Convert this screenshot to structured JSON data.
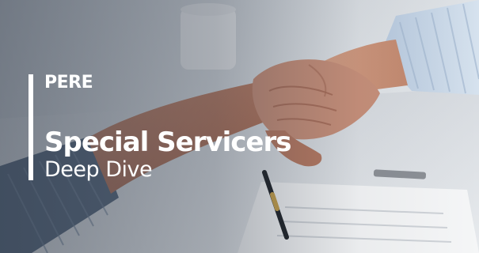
{
  "banner": {
    "kicker": "PERE",
    "title": "Special Servicers",
    "subtitle": "Deep Dive"
  },
  "colors": {
    "text": "#ffffff",
    "accent_bar": "#ffffff",
    "overlay": "#283241"
  },
  "background": {
    "icon": "handshake-photo"
  }
}
